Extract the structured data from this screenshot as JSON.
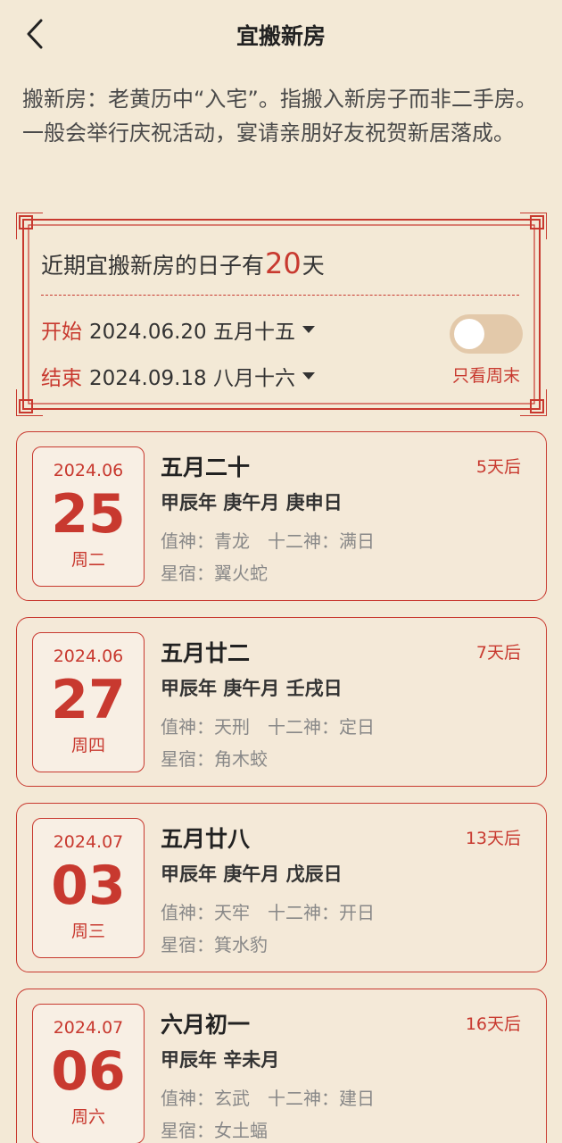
{
  "header": {
    "title": "宜搬新房"
  },
  "intro": "搬新房：老黄历中“入宅”。指搬入新房子而非二手房。一般会举行庆祝活动，宴请亲朋好友祝贺新居落成。",
  "summary": {
    "prefix": "近期宜搬新房的日子有",
    "count": "20",
    "suffix": "天",
    "start_label": "开始",
    "start_value": "2024.06.20 五月十五",
    "end_label": "结束",
    "end_value": "2024.09.18 八月十六",
    "weekend_label": "只看周末",
    "weekend_only": false
  },
  "days": [
    {
      "ym": "2024.06",
      "day": "25",
      "week": "周二",
      "lunar": "五月二十",
      "ganzhi": "甲辰年 庚午月 庚申日",
      "shen": "值神：青龙　十二神：满日",
      "xiu": "星宿：翼火蛇",
      "after": "5天后"
    },
    {
      "ym": "2024.06",
      "day": "27",
      "week": "周四",
      "lunar": "五月廿二",
      "ganzhi": "甲辰年 庚午月 壬戌日",
      "shen": "值神：天刑　十二神：定日",
      "xiu": "星宿：角木蛟",
      "after": "7天后"
    },
    {
      "ym": "2024.07",
      "day": "03",
      "week": "周三",
      "lunar": "五月廿八",
      "ganzhi": "甲辰年 庚午月 戊辰日",
      "shen": "值神：天牢　十二神：开日",
      "xiu": "星宿：箕水豹",
      "after": "13天后"
    },
    {
      "ym": "2024.07",
      "day": "06",
      "week": "周六",
      "lunar": "六月初一",
      "ganzhi": "甲辰年 辛未月",
      "shen": "值神：玄武　十二神：建日",
      "xiu": "星宿：女土蝠",
      "after": "16天后"
    }
  ],
  "colors": {
    "accent": "#c8392f",
    "background": "#f3e9d6",
    "toggle_track": "#e3c9aa"
  }
}
